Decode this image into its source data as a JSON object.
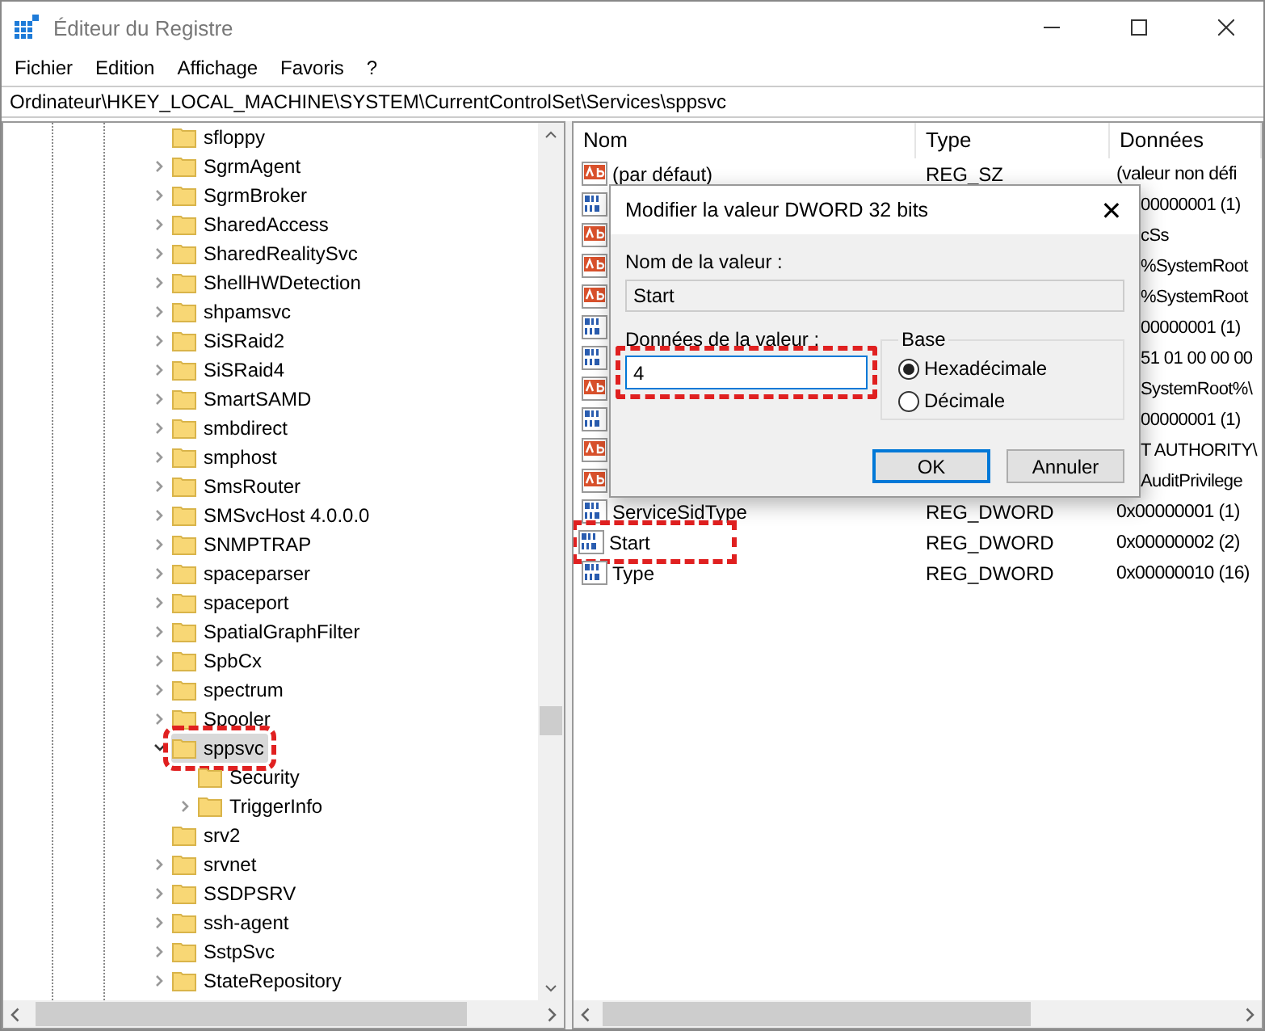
{
  "window": {
    "title": "Éditeur du Registre"
  },
  "menu": [
    "Fichier",
    "Edition",
    "Affichage",
    "Favoris",
    "?"
  ],
  "address": "Ordinateur\\HKEY_LOCAL_MACHINE\\SYSTEM\\CurrentControlSet\\Services\\sppsvc",
  "tree": [
    {
      "label": "sfloppy",
      "kind": "leaf",
      "selected": false,
      "annotated": false
    },
    {
      "label": "SgrmAgent",
      "kind": "collapsed",
      "selected": false,
      "annotated": false
    },
    {
      "label": "SgrmBroker",
      "kind": "collapsed",
      "selected": false,
      "annotated": false
    },
    {
      "label": "SharedAccess",
      "kind": "collapsed",
      "selected": false,
      "annotated": false
    },
    {
      "label": "SharedRealitySvc",
      "kind": "collapsed",
      "selected": false,
      "annotated": false
    },
    {
      "label": "ShellHWDetection",
      "kind": "collapsed",
      "selected": false,
      "annotated": false
    },
    {
      "label": "shpamsvc",
      "kind": "collapsed",
      "selected": false,
      "annotated": false
    },
    {
      "label": "SiSRaid2",
      "kind": "collapsed",
      "selected": false,
      "annotated": false
    },
    {
      "label": "SiSRaid4",
      "kind": "collapsed",
      "selected": false,
      "annotated": false
    },
    {
      "label": "SmartSAMD",
      "kind": "collapsed",
      "selected": false,
      "annotated": false
    },
    {
      "label": "smbdirect",
      "kind": "collapsed",
      "selected": false,
      "annotated": false
    },
    {
      "label": "smphost",
      "kind": "collapsed",
      "selected": false,
      "annotated": false
    },
    {
      "label": "SmsRouter",
      "kind": "collapsed",
      "selected": false,
      "annotated": false
    },
    {
      "label": "SMSvcHost 4.0.0.0",
      "kind": "collapsed",
      "selected": false,
      "annotated": false
    },
    {
      "label": "SNMPTRAP",
      "kind": "collapsed",
      "selected": false,
      "annotated": false
    },
    {
      "label": "spaceparser",
      "kind": "collapsed",
      "selected": false,
      "annotated": false
    },
    {
      "label": "spaceport",
      "kind": "collapsed",
      "selected": false,
      "annotated": false
    },
    {
      "label": "SpatialGraphFilter",
      "kind": "collapsed",
      "selected": false,
      "annotated": false
    },
    {
      "label": "SpbCx",
      "kind": "collapsed",
      "selected": false,
      "annotated": false
    },
    {
      "label": "spectrum",
      "kind": "collapsed",
      "selected": false,
      "annotated": false
    },
    {
      "label": "Spooler",
      "kind": "collapsed",
      "selected": false,
      "annotated": false
    },
    {
      "label": "sppsvc",
      "kind": "expanded",
      "selected": true,
      "annotated": true,
      "children": [
        {
          "label": "Security",
          "kind": "leaf",
          "selected": false,
          "annotated": false
        },
        {
          "label": "TriggerInfo",
          "kind": "collapsed",
          "selected": false,
          "annotated": false
        }
      ]
    },
    {
      "label": "srv2",
      "kind": "leaf",
      "selected": false,
      "annotated": false
    },
    {
      "label": "srvnet",
      "kind": "collapsed",
      "selected": false,
      "annotated": false
    },
    {
      "label": "SSDPSRV",
      "kind": "collapsed",
      "selected": false,
      "annotated": false
    },
    {
      "label": "ssh-agent",
      "kind": "collapsed",
      "selected": false,
      "annotated": false
    },
    {
      "label": "SstpSvc",
      "kind": "collapsed",
      "selected": false,
      "annotated": false
    },
    {
      "label": "StateRepository",
      "kind": "collapsed",
      "selected": false,
      "annotated": false
    }
  ],
  "values": {
    "columns": [
      "Nom",
      "Type",
      "Données"
    ],
    "rows": [
      {
        "kind": "string",
        "name": "(par défaut)",
        "type": "REG_SZ",
        "data": "(valeur non défi",
        "annotated": false
      },
      {
        "kind": "binary",
        "data": "00000001 (1)",
        "annotated": false
      },
      {
        "kind": "string",
        "data": "cSs",
        "annotated": false
      },
      {
        "kind": "string",
        "data": "%SystemRoot",
        "annotated": false
      },
      {
        "kind": "string",
        "data": "%SystemRoot",
        "annotated": false
      },
      {
        "kind": "binary",
        "data": "00000001 (1)",
        "annotated": false
      },
      {
        "kind": "binary",
        "data": "51 01 00 00 00",
        "annotated": false
      },
      {
        "kind": "string",
        "data": "SystemRoot%\\",
        "annotated": false
      },
      {
        "kind": "binary",
        "data": "00000001 (1)",
        "annotated": false
      },
      {
        "kind": "string",
        "data": "T AUTHORITY\\",
        "annotated": false
      },
      {
        "kind": "string",
        "data": "AuditPrivilege",
        "annotated": false
      },
      {
        "kind": "binary",
        "name": "ServiceSidType",
        "type": "REG_DWORD",
        "data": "0x00000001 (1)",
        "annotated": false
      },
      {
        "kind": "binary",
        "name": "Start",
        "type": "REG_DWORD",
        "data": "0x00000002 (2)",
        "annotated": true
      },
      {
        "kind": "binary",
        "name": "Type",
        "type": "REG_DWORD",
        "data": "0x00000010 (16)",
        "annotated": false
      }
    ]
  },
  "dialog": {
    "title": "Modifier la valeur DWORD 32 bits",
    "close": "✕",
    "name_label": "Nom de la valeur :",
    "name_value": "Start",
    "data_label": "Données de la valeur :",
    "data_value": "4",
    "data_annotated": true,
    "base_label": "Base",
    "bases": [
      {
        "label": "Hexadécimale",
        "selected": true
      },
      {
        "label": "Décimale",
        "selected": false
      }
    ],
    "buttons": [
      {
        "label": "OK",
        "default": true
      },
      {
        "label": "Annuler",
        "default": false
      }
    ]
  }
}
